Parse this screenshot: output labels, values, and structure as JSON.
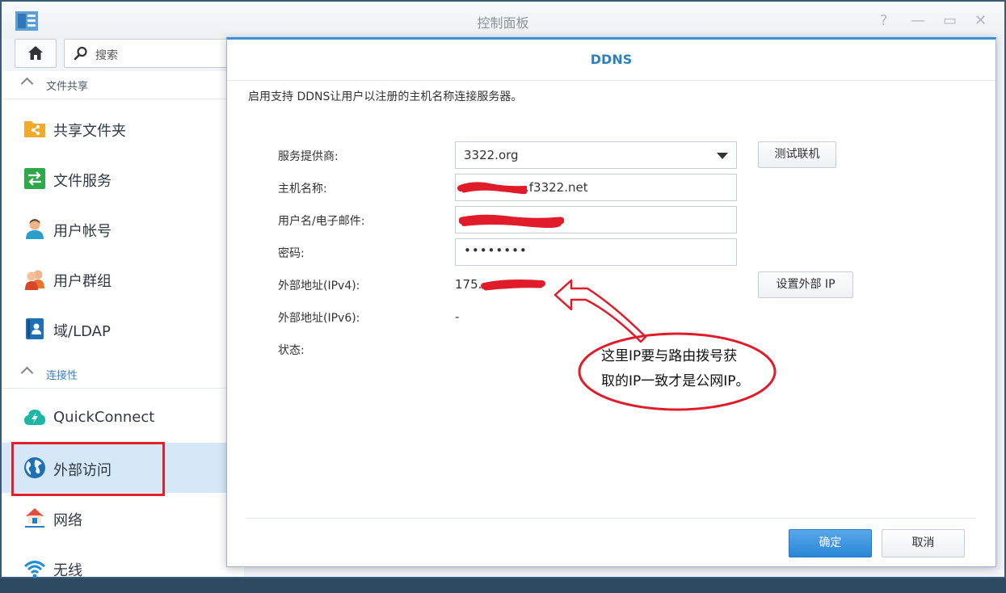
{
  "window": {
    "title": "控制面板",
    "controls": [
      "?",
      "—",
      "▭",
      "✕"
    ]
  },
  "toolbar": {
    "home_icon": "home-icon",
    "search_placeholder": "搜索"
  },
  "sidebar": {
    "sections": [
      {
        "label": "文件共享",
        "items": [
          {
            "label": "共享文件夹",
            "icon": "shared-folder-icon"
          },
          {
            "label": "文件服务",
            "icon": "file-services-icon"
          },
          {
            "label": "用户帐号",
            "icon": "user-icon"
          },
          {
            "label": "用户群组",
            "icon": "group-icon"
          },
          {
            "label": "域/LDAP",
            "icon": "domain-ldap-icon"
          }
        ]
      },
      {
        "label": "连接性",
        "items": [
          {
            "label": "QuickConnect",
            "icon": "quickconnect-icon"
          },
          {
            "label": "外部访问",
            "icon": "globe-icon",
            "active": true
          },
          {
            "label": "网络",
            "icon": "network-icon"
          },
          {
            "label": "无线",
            "icon": "wifi-icon"
          }
        ]
      }
    ]
  },
  "dialog": {
    "title": "DDNS",
    "description": "启用支持 DDNS让用户以注册的主机名称连接服务器。",
    "fields": {
      "provider_label": "服务提供商:",
      "provider_value": "3322.org",
      "hostname_label": "主机名称:",
      "hostname_value": ".f3322.net",
      "username_label": "用户名/电子邮件:",
      "username_value": "",
      "password_label": "密码:",
      "password_value": "••••••••",
      "ipv4_label": "外部地址(IPv4):",
      "ipv4_value": "175.",
      "ipv6_label": "外部地址(IPv6):",
      "ipv6_value": "-",
      "status_label": "状态:"
    },
    "test_button": "测试联机",
    "set_ip_button": "设置外部 IP",
    "ok_button": "确定",
    "cancel_button": "取消"
  },
  "annotation": {
    "line1": "这里IP要与路由拨号获",
    "line2": "取的IP一致才是公网IP。"
  },
  "colors": {
    "accent": "#3f8fd6",
    "annotation_red": "#e0202a",
    "active_bg": "#d6e8f7"
  }
}
